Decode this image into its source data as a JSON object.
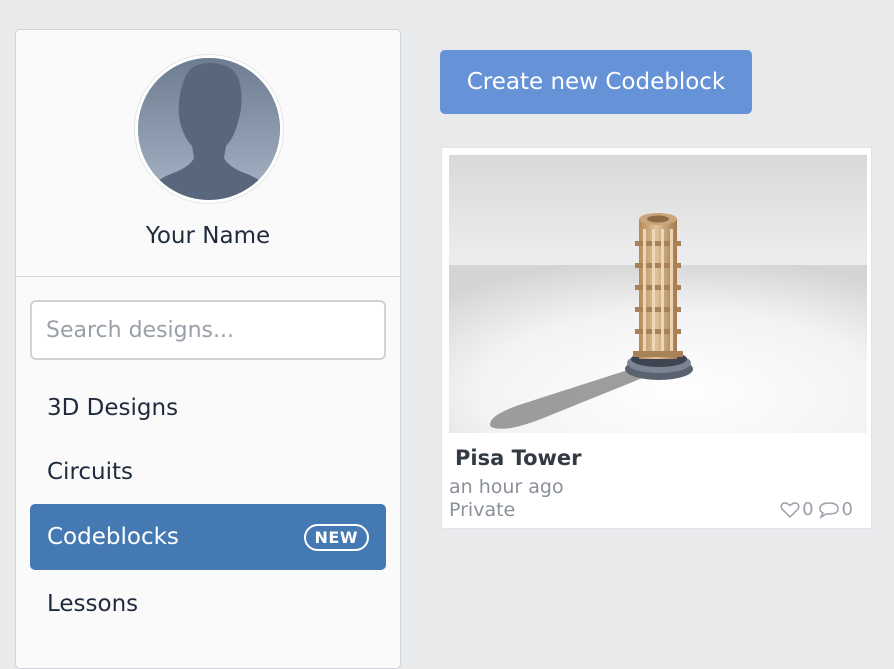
{
  "profile": {
    "name": "Your Name"
  },
  "search": {
    "placeholder": "Search designs..."
  },
  "nav": {
    "items": [
      {
        "label": "3D Designs",
        "active": false
      },
      {
        "label": "Circuits",
        "active": false
      },
      {
        "label": "Codeblocks",
        "active": true,
        "badge": "NEW"
      },
      {
        "label": "Lessons",
        "active": false
      }
    ]
  },
  "main": {
    "create_button_label": "Create new Codeblock",
    "designs": [
      {
        "title": "Pisa Tower",
        "time": "an hour ago",
        "privacy": "Private",
        "likes": "0",
        "comments": "0",
        "thumbnail_icon": "pisa-tower-render"
      }
    ]
  },
  "colors": {
    "background": "#e9eaec",
    "active_nav": "#4479b3",
    "create_button": "#6692d8",
    "text": "#1f2a3c",
    "muted_text": "#8a9099"
  }
}
